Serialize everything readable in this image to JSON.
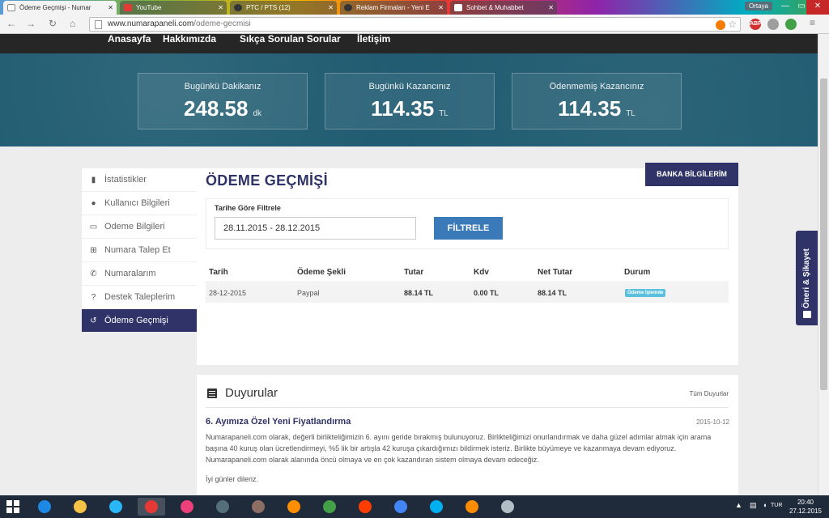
{
  "browser": {
    "tabs": [
      {
        "label": "Ödeme Geçmişi - Numar",
        "active": true,
        "icon_color": "#555555"
      },
      {
        "label": "YouTube",
        "active": false,
        "icon_color": "#e53935"
      },
      {
        "label": "PTC / PTS (12)",
        "active": false,
        "icon_color": "#333333"
      },
      {
        "label": "Reklam Firmaları - Yeni E",
        "active": false,
        "icon_color": "#333333"
      },
      {
        "label": "Sohbet & Muhabbet",
        "active": false,
        "icon_color": "#ffffff"
      }
    ],
    "profile": "Ortaya",
    "url_host": "www.numarapaneli.com",
    "url_path": "/odeme-gecmisi",
    "extensions": [
      {
        "name": "adblock-icon",
        "label": "ABP",
        "color": "#d32f2f"
      }
    ]
  },
  "topnav": {
    "items": [
      "Anasayfa",
      "Hakkımızda",
      "Sıkça Sorulan Sorular",
      "İletişim"
    ]
  },
  "stats": [
    {
      "label": "Bugünkü Dakikanız",
      "value": "248.58",
      "unit": "dk"
    },
    {
      "label": "Bugünkü Kazancınız",
      "value": "114.35",
      "unit": "TL"
    },
    {
      "label": "Ödenmemiş Kazancınız",
      "value": "114.35",
      "unit": "TL"
    }
  ],
  "sidebar": {
    "items": [
      {
        "label": "İstatistikler",
        "icon": "bar-chart-icon",
        "glyph": "▮",
        "active": false
      },
      {
        "label": "Kullanıcı Bilgileri",
        "icon": "user-icon",
        "glyph": "●",
        "active": false
      },
      {
        "label": "Odeme Bilgileri",
        "icon": "credit-card-icon",
        "glyph": "▭",
        "active": false
      },
      {
        "label": "Numara Talep Et",
        "icon": "plus-square-icon",
        "glyph": "⊞",
        "active": false
      },
      {
        "label": "Numaralarım",
        "icon": "phone-icon",
        "glyph": "✆",
        "active": false
      },
      {
        "label": "Destek Taleplerim",
        "icon": "help-icon",
        "glyph": "?",
        "active": false
      },
      {
        "label": "Ödeme Geçmişi",
        "icon": "history-icon",
        "glyph": "↺",
        "active": true
      }
    ]
  },
  "main": {
    "title": "ÖDEME GEÇMİŞİ",
    "bank_button": "BANKA BİLGİLERİM",
    "filter": {
      "label": "Tarihe Göre Filtrele",
      "value": "28.11.2015 - 28.12.2015",
      "button": "FİLTRELE"
    },
    "table": {
      "columns": [
        "Tarih",
        "Ödeme Şekli",
        "Tutar",
        "Kdv",
        "Net Tutar",
        "Durum"
      ],
      "rows": [
        {
          "tarih": "28-12-2015",
          "odeme_sekli": "Paypal",
          "tutar": "88.14 TL",
          "kdv": "0.00 TL",
          "net_tutar": "88.14 TL",
          "durum": "Ödeme İşlemde"
        }
      ]
    }
  },
  "announcements": {
    "title": "Duyurular",
    "all_link": "Tüm Duyurlar",
    "items": [
      {
        "title": "6. Ayımıza Özel Yeni Fiyatlandırma",
        "date": "2015-10-12",
        "body": "Numarapaneli.com olarak, değerli birlikteliğimizin 6. ayını geride bırakmış bulunuyoruz. Birlikteliğimizi onurlandırmak ve daha güzel adımlar atmak için arama başına 40 kuruş olan ücretlendirmeyi, %5 lik bir artışla 42 kuruşa çıkardığımızı bildirmek isteriz. Birlikte büyümeye ve kazanmaya devam ediyoruz. Numarapaneli.com olarak alanında öncü olmaya ve en çok kazandıran sistem olmaya devam edeceğiz.",
        "sign": "İyi günler dileriz."
      }
    ]
  },
  "feedback_tab": "Öneri & Şikayet",
  "taskbar": {
    "apps": [
      {
        "name": "internet-explorer-icon",
        "color": "#1e88e5",
        "active": false
      },
      {
        "name": "file-explorer-icon",
        "color": "#f6c344",
        "active": false
      },
      {
        "name": "webcam-app-icon",
        "color": "#29b6f6",
        "active": false
      },
      {
        "name": "chrome-icon",
        "color": "#e53935",
        "active": true
      },
      {
        "name": "itunes-icon",
        "color": "#ec407a",
        "active": false
      },
      {
        "name": "wordpress-icon",
        "color": "#546e7a",
        "active": false
      },
      {
        "name": "system-tool-icon",
        "color": "#8d6e63",
        "active": false
      },
      {
        "name": "vlc-icon",
        "color": "#ff8f00",
        "active": false
      },
      {
        "name": "store-icon",
        "color": "#43a047",
        "active": false
      },
      {
        "name": "yandex-icon",
        "color": "#ff3d00",
        "active": false
      },
      {
        "name": "google-icon",
        "color": "#4285f4",
        "active": false
      },
      {
        "name": "skype-icon",
        "color": "#00aff0",
        "active": false
      },
      {
        "name": "media-player-icon",
        "color": "#fb8c00",
        "active": false
      },
      {
        "name": "paint-icon",
        "color": "#b0bec5",
        "active": false
      }
    ],
    "time": "20:40",
    "date": "27.12.2015",
    "lang": "TUR"
  }
}
